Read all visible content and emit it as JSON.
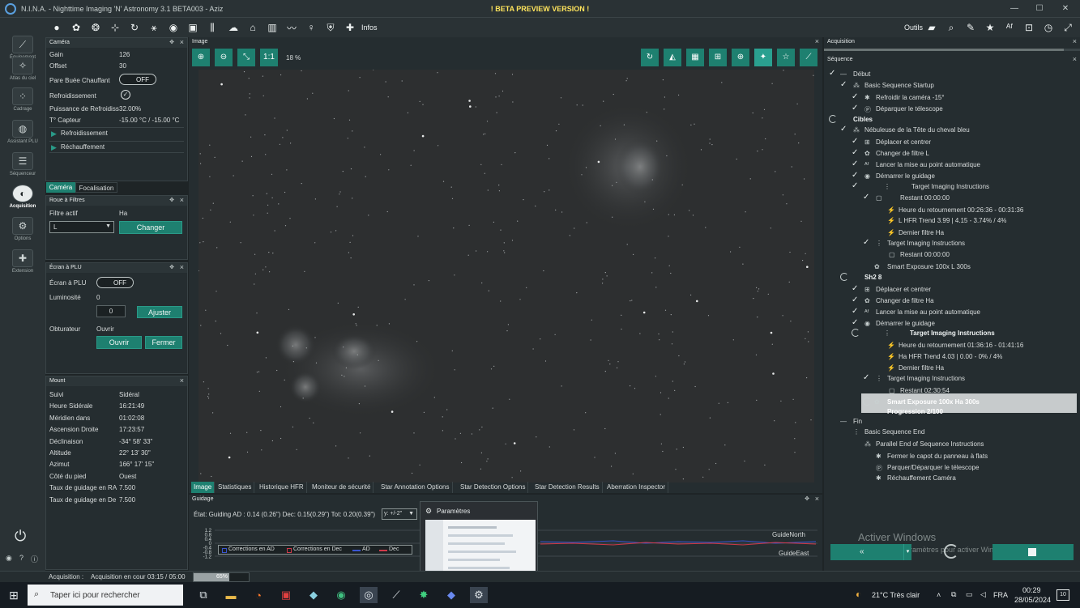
{
  "titlebar": {
    "app_title": "N.I.N.A. - Nighttime Imaging 'N' Astronomy 3.1 BETA003  -  Aziz",
    "beta_banner": "! BETA PREVIEW VERSION !",
    "min": "—",
    "max": "☐",
    "close": "✕"
  },
  "toolbar": {
    "infos_label": "Infos",
    "outils_label": "Outils"
  },
  "sidebar": {
    "items": [
      {
        "label": "Équipement",
        "icon": "telescope-icon"
      },
      {
        "label": "Atlas du ciel",
        "icon": "sky-atlas-icon"
      },
      {
        "label": "Cadrage",
        "icon": "framing-icon"
      },
      {
        "label": "Assistant PLU",
        "icon": "flat-wizard-icon"
      },
      {
        "label": "Séquenceur",
        "icon": "sequencer-icon"
      },
      {
        "label": "Acquisition",
        "icon": "acquisition-icon"
      },
      {
        "label": "Options",
        "icon": "gear-icon"
      },
      {
        "label": "Extension",
        "icon": "puzzle-icon"
      }
    ]
  },
  "camera": {
    "title": "Caméra",
    "gain_label": "Gain",
    "gain_value": "126",
    "offset_label": "Offset",
    "offset_value": "30",
    "dew_label": "Pare Buée Chauffant",
    "dew_state": "OFF",
    "cooling_label": "Refroidissement",
    "power_label": "Puissance de Refroidiss",
    "power_value": "32.00%",
    "temp_label": "T° Capteur",
    "temp_value": "-15.00 °C / -15.00 °C",
    "expander_cool": "Refroidissement",
    "expander_warm": "Réchauffement",
    "tab_camera": "Caméra",
    "tab_focus": "Focalisation"
  },
  "filterwheel": {
    "title": "Roue à Filtres",
    "active_label": "Filtre actif",
    "active_value": "Ha",
    "select_value": "L",
    "change_button": "Changer"
  },
  "flat": {
    "title": "Écran à PLU",
    "screen_label": "Écran à PLU",
    "screen_state": "OFF",
    "brightness_label": "Luminosité",
    "brightness_value": "0",
    "input_value": "0",
    "adjust_button": "Ajuster",
    "shutter_label": "Obturateur",
    "shutter_value": "Ouvrir",
    "open_button": "Ouvrir",
    "close_button": "Fermer"
  },
  "mount": {
    "title": "Mount",
    "rows": [
      {
        "label": "Suivi",
        "value": "Sidéral"
      },
      {
        "label": "Heure Sidérale",
        "value": "16:21:49"
      },
      {
        "label": "Méridien dans",
        "value": "01:02:08"
      },
      {
        "label": "Ascension Droite",
        "value": "17:23:57"
      },
      {
        "label": "Déclinaison",
        "value": "-34° 58' 33\""
      },
      {
        "label": "Altitude",
        "value": "22° 13' 30\""
      },
      {
        "label": "Azimut",
        "value": "166° 17' 15\""
      },
      {
        "label": "Côté du pied",
        "value": "Ouest"
      },
      {
        "label": "Taux de guidage en RA",
        "value": "7.500"
      },
      {
        "label": "Taux de guidage en De",
        "value": "7.500"
      }
    ]
  },
  "image": {
    "title": "Image",
    "zoom_1to1": "1:1",
    "zoom_level": "18 %"
  },
  "tabs": [
    "Image",
    "Statistiques",
    "Historique HFR",
    "Moniteur de sécurité",
    "Star Annotation Options",
    "Star Detection Options",
    "Star Detection Results",
    "Aberration Inspector"
  ],
  "guiding": {
    "title": "Guidage",
    "state": "État: Guiding AD : 0.14 (0.26\")  Dec: 0.15(0.29\")  Tot: 0.20(0.39\")",
    "y_select": "y: +/-2\"",
    "y_ticks": [
      "1.2",
      "0.8",
      "0.4",
      "0",
      "-0.4",
      "-0.8",
      "-1.2"
    ],
    "legend": [
      "Corrections en AD",
      "Corrections en Dec",
      "AD",
      "Dec"
    ],
    "north": "GuideNorth",
    "east": "GuideEast"
  },
  "popup": {
    "title": "Paramètres"
  },
  "sequence": {
    "panel_title": "Acquisition",
    "section_title": "Séquence",
    "items": [
      {
        "text": "Début"
      },
      {
        "text": "Basic Sequence Startup"
      },
      {
        "text": "Refroidir la caméra -15°"
      },
      {
        "text": "Déparquer le télescope"
      },
      {
        "text": "Cibles"
      },
      {
        "text": "Nébuleuse de la Tête du cheval bleu"
      },
      {
        "text": "Déplacer et centrer"
      },
      {
        "text": "Changer de filtre L"
      },
      {
        "text": "Lancer la mise au point automatique"
      },
      {
        "text": "Démarrer le guidage"
      },
      {
        "text": "Target Imaging Instructions"
      },
      {
        "text": "Restant 00:00:00"
      },
      {
        "text": "Heure du retournement 00:26:36 - 00:31:36"
      },
      {
        "text": "L  HFR Trend 3.99 | 4.15 - 3.74% / 4%"
      },
      {
        "text": "Dernier filtre Ha"
      },
      {
        "text": "Target Imaging Instructions"
      },
      {
        "text": "Restant 00:00:00"
      },
      {
        "text": "Smart Exposure 100x L 300s"
      },
      {
        "text": "Sh2 8"
      },
      {
        "text": "Déplacer et centrer"
      },
      {
        "text": "Changer de filtre Ha"
      },
      {
        "text": "Lancer la mise au point automatique"
      },
      {
        "text": "Démarrer le guidage"
      },
      {
        "text": "Target Imaging Instructions"
      },
      {
        "text": "Heure du retournement 01:36:16 - 01:41:16"
      },
      {
        "text": "Ha  HFR Trend 4.03 | 0.00 - 0% / 4%"
      },
      {
        "text": "Dernier filtre Ha"
      },
      {
        "text": "Target Imaging Instructions"
      },
      {
        "text": "Restant 02:30:54"
      },
      {
        "text": "Smart Exposure 100x Ha 300s"
      },
      {
        "text": "Progression 2/100"
      },
      {
        "text": "Fin"
      },
      {
        "text": "Basic Sequence End"
      },
      {
        "text": "Parallel End of Sequence Instructions"
      },
      {
        "text": "Fermer le capot du panneau à flats"
      },
      {
        "text": "Parquer/Déparquer le télescope"
      },
      {
        "text": "Réchauffement Caméra"
      }
    ],
    "watermark_title": "Activer Windows",
    "watermark_sub": "Accédez aux paramètres pour activer Windows."
  },
  "status": {
    "label": "Acquisition :",
    "text": "Acquisition en cour 03:15 / 05:00",
    "progress_text": "65%",
    "progress": 0.65
  },
  "taskbar": {
    "search_placeholder": "Taper ici pour rechercher",
    "weather": "21°C  Très clair",
    "lang": "FRA",
    "time": "00:29",
    "date": "28/05/2024",
    "notif": "10"
  },
  "colors": {
    "accent": "#1e8070",
    "beta": "#ffe45c",
    "bg": "#1e2426"
  }
}
